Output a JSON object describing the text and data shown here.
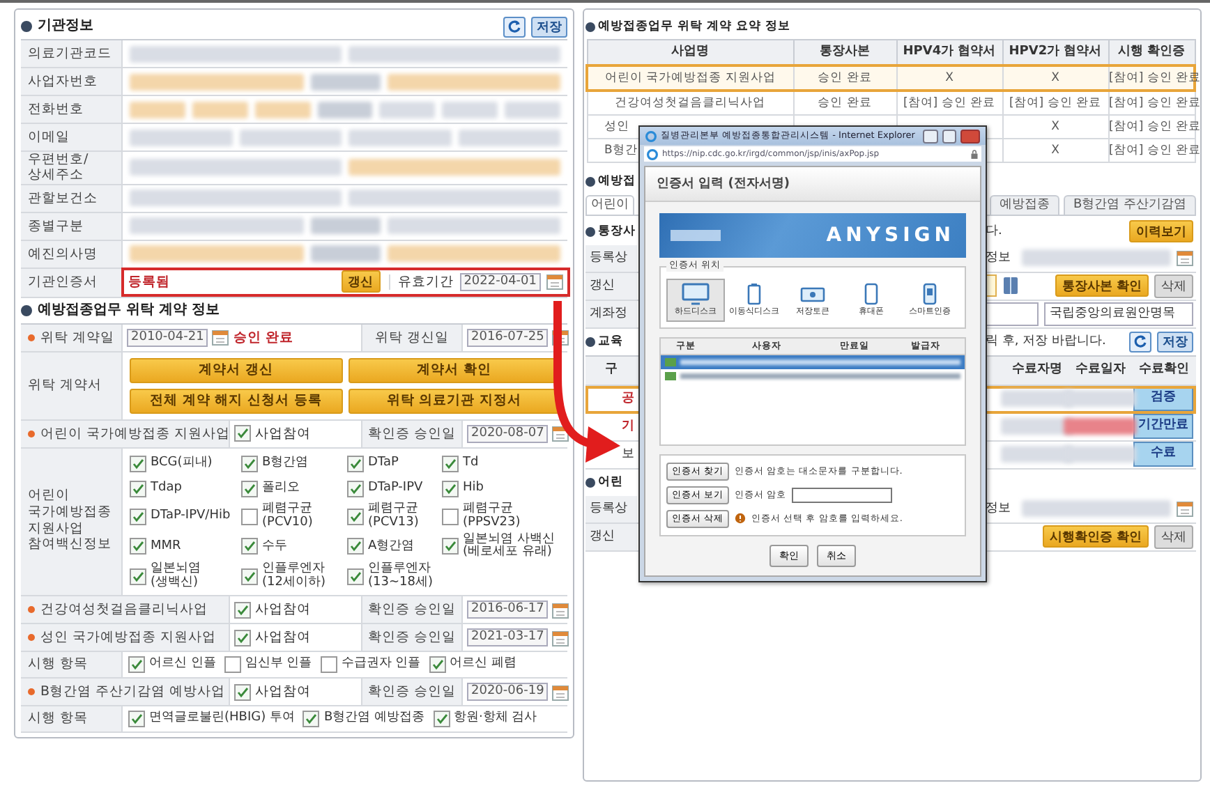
{
  "institution": {
    "title": "기관정보",
    "save_button": "저장",
    "rows": [
      {
        "label": "의료기관코드",
        "fields": [
          {
            "kind": "plain"
          },
          {
            "kind": "plain"
          }
        ]
      },
      {
        "label": "사업자번호",
        "fields": [
          {
            "kind": "required"
          },
          {
            "kind": "label"
          },
          {
            "kind": "required"
          }
        ]
      },
      {
        "label": "전화번호",
        "fields": [
          {
            "kind": "required"
          },
          {
            "kind": "required"
          },
          {
            "kind": "required"
          },
          {
            "kind": "label"
          },
          {
            "kind": "plain"
          },
          {
            "kind": "plain"
          },
          {
            "kind": "plain"
          }
        ]
      },
      {
        "label": "이메일",
        "fields": [
          {
            "kind": "plain"
          },
          {
            "kind": "plain"
          },
          {
            "kind": "plain"
          },
          {
            "kind": "plain"
          }
        ]
      },
      {
        "label": "우편번호/\n상세주소",
        "fields": [
          {
            "kind": "plain"
          },
          {
            "kind": "required"
          }
        ]
      },
      {
        "label": "관할보건소",
        "fields": [
          {
            "kind": "plain"
          },
          {
            "kind": "plain"
          }
        ]
      },
      {
        "label": "종별구분",
        "fields": [
          {
            "kind": "plain"
          },
          {
            "kind": "label"
          },
          {
            "kind": "plain"
          }
        ]
      },
      {
        "label": "예진의사명",
        "fields": [
          {
            "kind": "required"
          },
          {
            "kind": "label"
          },
          {
            "kind": "required"
          }
        ]
      }
    ],
    "certificate": {
      "label": "기관인증서",
      "status": "등록됨",
      "renew_button": "갱신",
      "validity_label": "유효기간",
      "validity": "2022-04-01"
    }
  },
  "contract": {
    "title": "예방접종업무 위탁 계약 정보",
    "contract_row": {
      "label": "위탁 계약일",
      "required": true,
      "date": "2010-04-21",
      "status": "승인 완료",
      "renew_label": "위탁 갱신일",
      "renew_date": "2016-07-25"
    },
    "documents": {
      "label": "위탁 계약서",
      "buttons": [
        "계약서 갱신",
        "계약서 확인",
        "전체 계약 해지 신청서 등록",
        "위탁 의료기관 지정서"
      ]
    },
    "sections": [
      {
        "kind": "program",
        "label": "어린이 국가예방접종 지원사업",
        "required": true,
        "participate": {
          "label": "사업참여",
          "checked": true
        },
        "confirm_label": "확인증 승인일",
        "date": "2020-08-07"
      },
      {
        "kind": "vaccines",
        "label": "어린이\n국가예방접종\n지원사업\n참여백신정보",
        "items": [
          {
            "label": "BCG(피내)",
            "checked": true
          },
          {
            "label": "B형간염",
            "checked": true
          },
          {
            "label": "DTaP",
            "checked": true
          },
          {
            "label": "Td",
            "checked": true
          },
          {
            "label": "Tdap",
            "checked": true
          },
          {
            "label": "폴리오",
            "checked": true
          },
          {
            "label": "DTaP-IPV",
            "checked": true
          },
          {
            "label": "Hib",
            "checked": true
          },
          {
            "label": "DTaP-IPV/Hib",
            "checked": true
          },
          {
            "label": "폐렴구균\n(PCV10)",
            "checked": false
          },
          {
            "label": "폐렴구균\n(PCV13)",
            "checked": true
          },
          {
            "label": "폐렴구균\n(PPSV23)",
            "checked": false
          },
          {
            "label": "MMR",
            "checked": true
          },
          {
            "label": "수두",
            "checked": true
          },
          {
            "label": "A형간염",
            "checked": true
          },
          {
            "label": "일본뇌염 사백신\n(베로세포 유래)",
            "checked": true
          },
          {
            "label": "일본뇌염\n(생백신)",
            "checked": true
          },
          {
            "label": "인플루엔자\n(12세이하)",
            "checked": true
          },
          {
            "label": "인플루엔자\n(13~18세)",
            "checked": true
          }
        ]
      },
      {
        "kind": "program",
        "label": "건강여성첫걸음클리닉사업",
        "required": true,
        "participate": {
          "label": "사업참여",
          "checked": true
        },
        "confirm_label": "확인증 승인일",
        "date": "2016-06-17"
      },
      {
        "kind": "program",
        "label": "성인 국가예방접종 지원사업",
        "required": true,
        "participate": {
          "label": "사업참여",
          "checked": true
        },
        "confirm_label": "확인증 승인일",
        "date": "2021-03-17"
      },
      {
        "kind": "items",
        "label": "시행 항목",
        "items": [
          {
            "label": "어르신 인플",
            "checked": true
          },
          {
            "label": "임신부 인플",
            "checked": false
          },
          {
            "label": "수급권자 인플",
            "checked": false
          },
          {
            "label": "어르신 폐렴",
            "checked": true
          }
        ]
      },
      {
        "kind": "program",
        "label": "B형간염 주산기감염 예방사업",
        "required": true,
        "participate": {
          "label": "사업참여",
          "checked": true
        },
        "confirm_label": "확인증 승인일",
        "date": "2020-06-19"
      },
      {
        "kind": "items",
        "label": "시행 항목",
        "items": [
          {
            "label": "면역글로불린(HBIG) 투여",
            "checked": true
          },
          {
            "label": "B형간염 예방접종",
            "checked": true
          },
          {
            "label": "항원·항체 검사",
            "checked": true
          }
        ]
      }
    ]
  },
  "summary": {
    "title": "예방접종업무 위탁 계약 요약 정보",
    "columns": [
      "사업명",
      "통장사본",
      "HPV4가 협약서",
      "HPV2가 협약서",
      "시행 확인증"
    ],
    "rows": [
      {
        "selected": true,
        "name": "어린이 국가예방접종 지원사업",
        "bankbook": "승인 완료",
        "hpv4": "X",
        "hpv2": "X",
        "confirm": "[참여] 승인 완료"
      },
      {
        "selected": false,
        "name": "건강여성첫걸음클리닉사업",
        "bankbook": "승인 완료",
        "hpv4": "[참여] 승인 완료",
        "hpv2": "[참여] 승인 완료",
        "confirm": "[참여] 승인 완료"
      },
      {
        "selected": false,
        "name": "성인",
        "hpv2": "X",
        "confirm": "[참여] 승인 완료"
      },
      {
        "selected": false,
        "name": "B형간",
        "hpv2": "X",
        "confirm": "[참여] 승인 완료"
      }
    ]
  },
  "detail": {
    "title": "예방접",
    "tabs": [
      {
        "label": "어린이",
        "selected": true
      },
      {
        "label": "예방접종",
        "selected": false
      },
      {
        "label": "B형간염 주산기감염",
        "selected": false
      }
    ]
  },
  "bankbook": {
    "title": "통장사",
    "notice": "다.",
    "history_button": "이력보기",
    "reg_label": "등록상",
    "info_label": "정보",
    "update_label": "갱신",
    "confirm_button": "통장사본 확인",
    "delete_button": "삭제",
    "account_label": "계좌정",
    "account_name": "국립중앙의료원안명목"
  },
  "education": {
    "title": "교육",
    "notice": "릭 후, 저장 바랍니다.",
    "save_button": "저장",
    "columns": [
      "구",
      "수료자명",
      "수료일자",
      "수료확인"
    ],
    "rows": [
      {
        "name": "공",
        "selected": true,
        "alert": true,
        "expired": false,
        "status": "검증"
      },
      {
        "name": "기",
        "selected": false,
        "alert": true,
        "expired": true,
        "status": "기간만료"
      },
      {
        "name": "보",
        "selected": false,
        "alert": false,
        "expired": false,
        "status": "수료"
      }
    ]
  },
  "child_confirm": {
    "title": "어린",
    "reg_label": "등록상",
    "info_label": "정보",
    "update_label": "갱신",
    "confirm_button": "시행확인증 확인",
    "delete_button": "삭제"
  },
  "popup": {
    "window_title": "질병관리본부 예방접종통합관리시스템 - Internet Explorer",
    "url": "https://nip.cdc.go.kr/irgd/common/jsp/inis/axPop.jsp",
    "title": "인증서 입력 (전자서명)",
    "brand": "ANYSIGN",
    "location_label": "인증서 위치",
    "locations": [
      {
        "label": "하드디스크",
        "kind": "disk",
        "selected": true
      },
      {
        "label": "이동식디스크",
        "kind": "usb",
        "selected": false
      },
      {
        "label": "저장토큰",
        "kind": "token",
        "selected": false
      },
      {
        "label": "휴대폰",
        "kind": "phone",
        "selected": false
      },
      {
        "label": "스마트인증",
        "kind": "smart",
        "selected": false
      }
    ],
    "columns": [
      "구분",
      "사용자",
      "만료일",
      "발급자"
    ],
    "certs": [
      {
        "selected": true
      },
      {
        "selected": false
      }
    ],
    "side_buttons": [
      "인증서 찾기",
      "인증서 보기",
      "인증서 삭제"
    ],
    "case_note": "인증서 암호는 대소문자를 구분합니다.",
    "password_label": "인증서 암호",
    "warning": "인증서 선택 후 암호를 입력하세요.",
    "buttons": [
      "확인",
      "취소"
    ]
  }
}
